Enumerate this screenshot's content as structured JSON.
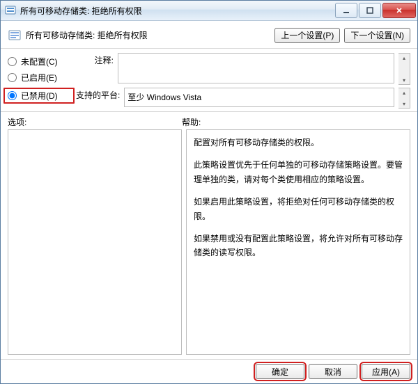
{
  "window": {
    "title": "所有可移动存储类: 拒绝所有权限"
  },
  "header": {
    "title": "所有可移动存储类: 拒绝所有权限",
    "prev_button": "上一个设置(P)",
    "next_button": "下一个设置(N)"
  },
  "config": {
    "radios": {
      "not_configured": "未配置(C)",
      "enabled": "已启用(E)",
      "disabled": "已禁用(D)"
    },
    "selected": "disabled",
    "comment_label": "注释:",
    "comment_value": "",
    "platform_label": "支持的平台:",
    "platform_value": "至少 Windows Vista"
  },
  "labels": {
    "options": "选项:",
    "help": "帮助:"
  },
  "help_paragraphs": [
    "配置对所有可移动存储类的权限。",
    "此策略设置优先于任何单独的可移动存储策略设置。要管理单独的类，请对每个类使用相应的策略设置。",
    "如果启用此策略设置，将拒绝对任何可移动存储类的权限。",
    "如果禁用或没有配置此策略设置，将允许对所有可移动存储类的读写权限。"
  ],
  "footer": {
    "ok": "确定",
    "cancel": "取消",
    "apply": "应用(A)"
  }
}
